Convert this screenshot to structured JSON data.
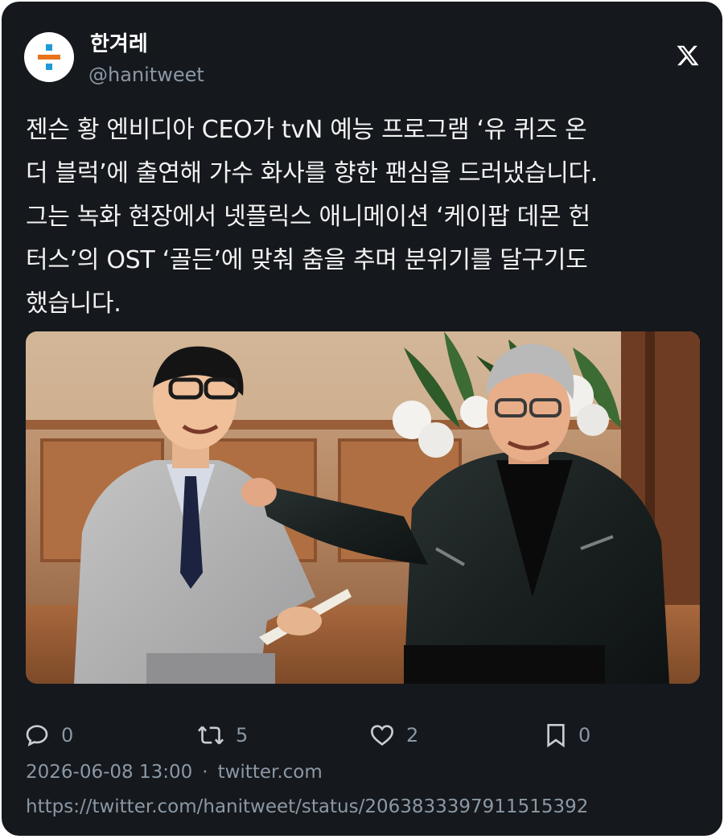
{
  "account": {
    "display_name": "한겨레",
    "handle": "@hanitweet",
    "avatar_icon": "hankyoreh-logo",
    "avatar_colors": {
      "top": "#1f9ad6",
      "middle": "#e8731c",
      "bottom": "#1f9ad6"
    }
  },
  "platform_icon": "x-logo-icon",
  "tweet": {
    "text": "젠슨 황 엔비디아 CEO가 tvN 예능 프로그램 ‘유 퀴즈 온\n더 블럭’에 출연해 가수 화사를 향한 팬심을 드러냈습니다.\n그는 녹화 현장에서 넷플릭스 애니메이션 ‘케이팝 데몬 헌\n터스’의 OST ‘골든’에 맞춰 춤을 추며 분위기를 달구기도\n했습니다."
  },
  "actions": {
    "reply": {
      "icon": "reply-icon",
      "count": "0"
    },
    "retweet": {
      "icon": "retweet-icon",
      "count": "5"
    },
    "like": {
      "icon": "heart-icon",
      "count": "2"
    },
    "bookmark": {
      "icon": "bookmark-icon",
      "count": "0"
    }
  },
  "meta": {
    "timestamp": "2026-06-08 13:00",
    "separator": "·",
    "source": "twitter.com",
    "url": "https://twitter.com/hanitweet/status/2063833397911515392"
  },
  "colors": {
    "card_background": "#15181c",
    "text_primary": "#e7e9ea",
    "text_secondary": "#8b98a5"
  }
}
